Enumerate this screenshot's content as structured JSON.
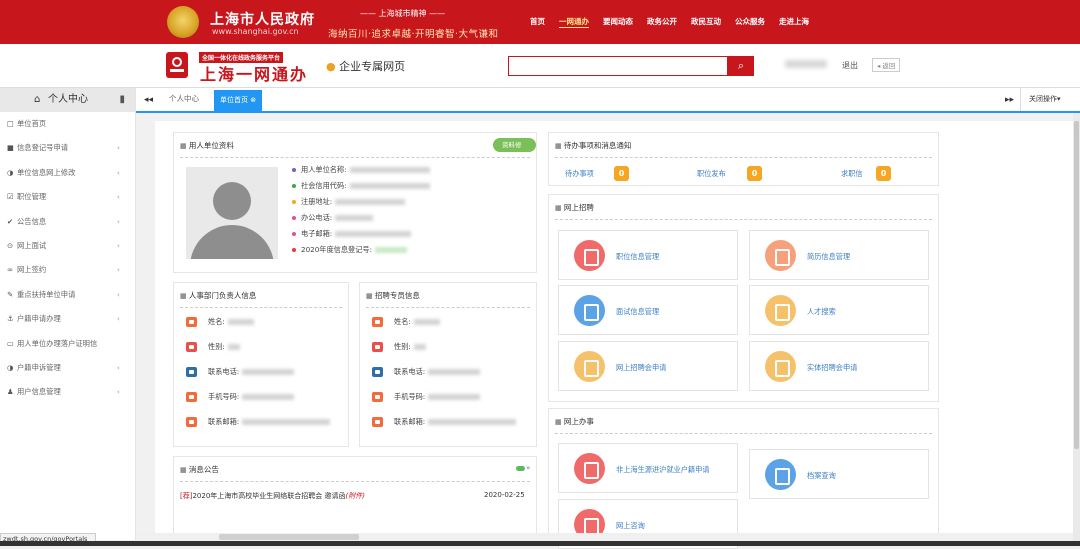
{
  "header": {
    "gov_title": "上海市人民政府",
    "gov_url": "www.shanghai.gov.cn",
    "spirit_title": "—— 上海城市精神 ——",
    "spirit_slogan": "海纳百川·追求卓越·开明睿智·大气谦和",
    "nav": [
      "首页",
      "一网通办",
      "要闻动态",
      "政务公开",
      "政民互动",
      "公众服务",
      "走进上海"
    ],
    "nav_active": "一网通办",
    "accent": "#c8161d"
  },
  "brand": {
    "platform_label": "全国一体化在线政务服务平台",
    "name": "上海一网通办",
    "enterprise_page": "企业专属网页",
    "search_placeholder": "",
    "logout": "退出",
    "back": "◂ 返回"
  },
  "sidebar": {
    "title": "个人中心",
    "items": [
      {
        "icon": "□",
        "label": "单位首页",
        "chevron": ""
      },
      {
        "icon": "■",
        "label": "信息登记号申请",
        "chevron": "‹"
      },
      {
        "icon": "◑",
        "label": "单位信息网上修改",
        "chevron": "‹"
      },
      {
        "icon": "☑",
        "label": "职位管理",
        "chevron": "‹"
      },
      {
        "icon": "✔",
        "label": "公告信息",
        "chevron": "‹"
      },
      {
        "icon": "⊙",
        "label": "网上面试",
        "chevron": "‹"
      },
      {
        "icon": "∞",
        "label": "网上签约",
        "chevron": "‹"
      },
      {
        "icon": "✎",
        "label": "重点扶持单位申请",
        "chevron": "‹"
      },
      {
        "icon": "⚓",
        "label": "户籍申请办理",
        "chevron": "‹"
      },
      {
        "icon": "▭",
        "label": "用人单位办理落户证明信",
        "chevron": ""
      },
      {
        "icon": "◑",
        "label": "户籍申诉管理",
        "chevron": "‹"
      },
      {
        "icon": "♟",
        "label": "用户信息管理",
        "chevron": "‹"
      }
    ]
  },
  "tabs": {
    "items": [
      "个人中心",
      "单位首页 ⊗"
    ],
    "close_ops": "关闭操作▾"
  },
  "unit_info": {
    "title": "用人单位资料",
    "modify_button": "资料修改",
    "fields": [
      {
        "label": "用人单位名称:",
        "color": "#6c63c9"
      },
      {
        "label": "社会信用代码:",
        "color": "#3aa844"
      },
      {
        "label": "注册地址:",
        "color": "#f5a623"
      },
      {
        "label": "办公电话:",
        "color": "#e04f9f"
      },
      {
        "label": "电子邮箱:",
        "color": "#e04f9f"
      },
      {
        "label": "2020年度信息登记号:",
        "color": "#e5383b"
      }
    ]
  },
  "hr_contact": {
    "title": "人事部门负责人信息",
    "rows": [
      {
        "label": "姓名:",
        "icon": "user-icon",
        "color": "#f26b3a"
      },
      {
        "label": "性别:",
        "icon": "gender-icon",
        "color": "#e8514a"
      },
      {
        "label": "联系电话:",
        "icon": "phone-icon",
        "color": "#2f6fa8"
      },
      {
        "label": "手机号码:",
        "icon": "mobile-icon",
        "color": "#f26b3a"
      },
      {
        "label": "联系邮箱:",
        "icon": "email-icon",
        "color": "#f26b3a"
      }
    ]
  },
  "recruit_contact": {
    "title": "招聘专员信息",
    "rows": [
      {
        "label": "姓名:",
        "icon": "user-icon",
        "color": "#f26b3a"
      },
      {
        "label": "性别:",
        "icon": "gender-icon",
        "color": "#e8514a"
      },
      {
        "label": "联系电话:",
        "icon": "phone-icon",
        "color": "#2f6fa8"
      },
      {
        "label": "手机号码:",
        "icon": "mobile-icon",
        "color": "#f26b3a"
      },
      {
        "label": "联系邮箱:",
        "icon": "email-icon",
        "color": "#f26b3a"
      }
    ]
  },
  "notices": {
    "title": "消息公告",
    "items": [
      {
        "tag": "[荐]",
        "text": "2020年上海市高校毕业生网络联合招聘会 邀请函",
        "attachment": "(附件)",
        "date": "2020-02-25"
      }
    ]
  },
  "todo": {
    "title": "待办事项和消息通知",
    "items": [
      {
        "label": "待办事项",
        "count": "0"
      },
      {
        "label": "职位发布",
        "count": "0"
      },
      {
        "label": "求职信",
        "count": "0"
      }
    ]
  },
  "online_recruit": {
    "title": "网上招聘",
    "cards": [
      {
        "label": "职位信息管理",
        "icon": "clipboard-icon",
        "color": "#f16a6a"
      },
      {
        "label": "简历信息管理",
        "icon": "people-icon",
        "color": "#f7a07c"
      },
      {
        "label": "面试信息管理",
        "icon": "bar-chart-icon",
        "color": "#5ba3e6"
      },
      {
        "label": "人才搜索",
        "icon": "image-icon",
        "color": "#f5c26b"
      },
      {
        "label": "网上招聘会申请",
        "icon": "picture-icon",
        "color": "#f5c26b"
      },
      {
        "label": "实体招聘会申请",
        "icon": "picture-icon",
        "color": "#f5c26b"
      }
    ]
  },
  "online_service": {
    "title": "网上办事",
    "cards": [
      {
        "label": "非上海生源进沪就业户籍申请",
        "icon": "stamp-icon",
        "color": "#f16a6a"
      },
      {
        "label": "档案查询",
        "icon": "bar-chart-icon",
        "color": "#5ba3e6"
      },
      {
        "label": "网上咨询",
        "icon": "clipboard-icon",
        "color": "#f16a6a"
      }
    ]
  },
  "statusbar": {
    "url": "zwdt.sh.gov.cn/govPortals"
  }
}
